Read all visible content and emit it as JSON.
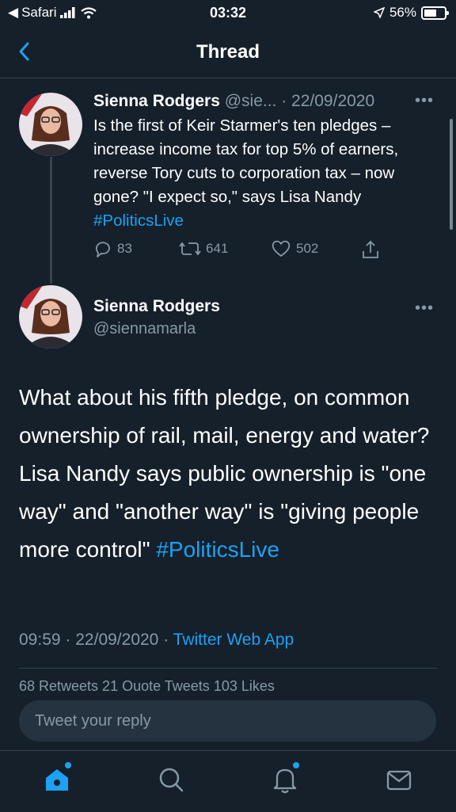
{
  "status_bar": {
    "carrier": "Safari",
    "time": "03:32",
    "battery_percent": "56%",
    "battery_level": 0.56
  },
  "header": {
    "title": "Thread"
  },
  "tweet1": {
    "name": "Sienna Rodgers",
    "handle": "@sie...",
    "date": "· 22/09/2020",
    "text": "Is the first of Keir Starmer's ten pledges – increase income tax for top 5% of earners, reverse Tory cuts to corporation tax – now gone? \"I expect so,\" says Lisa Nandy ",
    "hashtag": "#PoliticsLive",
    "replies": "83",
    "retweets": "641",
    "likes": "502"
  },
  "tweet2": {
    "name": "Sienna Rodgers",
    "handle": "@siennamarla",
    "text": "What about his fifth pledge, on common ownership of rail, mail, energy and water? Lisa Nandy says public ownership is \"one way\" and \"another way\" is \"giving people more control\" ",
    "hashtag": "#PoliticsLive",
    "time": "09:59",
    "date": "22/09/2020",
    "source": "Twitter Web App",
    "stats": "68 Retweets  21 Quote Tweets  103 Likes"
  },
  "reply": {
    "placeholder": "Tweet your reply"
  },
  "colors": {
    "background": "#15202b",
    "accent": "#1da1f2",
    "muted": "#8899a6",
    "border": "#38444d"
  },
  "icons": [
    "back-chevron-icon",
    "reply-icon",
    "retweet-icon",
    "like-icon",
    "share-icon",
    "more-icon",
    "home-icon",
    "search-icon",
    "notifications-icon",
    "messages-icon"
  ]
}
